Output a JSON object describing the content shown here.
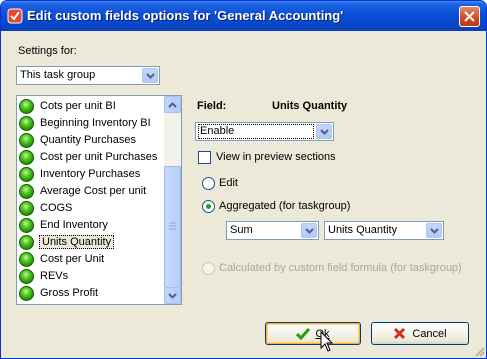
{
  "window": {
    "title": "Edit custom fields options for  'General Accounting'"
  },
  "settings": {
    "label": "Settings for:",
    "selected": "This task group"
  },
  "fields_list": {
    "items": [
      {
        "label": "Cots per unit BI"
      },
      {
        "label": "Beginning Inventory BI"
      },
      {
        "label": "Quantity Purchases"
      },
      {
        "label": "Cost per unit Purchases"
      },
      {
        "label": "Inventory Purchases"
      },
      {
        "label": "Average Cost per unit"
      },
      {
        "label": "COGS"
      },
      {
        "label": "End Inventory"
      },
      {
        "label": "Units Quantity",
        "selected": true
      },
      {
        "label": "Cost per Unit"
      },
      {
        "label": "REVs"
      },
      {
        "label": "Gross Profit"
      }
    ],
    "item_color": "#2fb012"
  },
  "field_panel": {
    "field_label": "Field:",
    "field_name": "Units Quantity",
    "mode_selected": "Enable",
    "view_in_preview_label": "View in preview sections",
    "view_in_preview_checked": false,
    "edit_label": "Edit",
    "aggregated_label": "Aggregated (for taskgroup)",
    "aggregated_selected": true,
    "aggregate_function": "Sum",
    "aggregate_field": "Units Quantity",
    "calculated_label": "Calculated by custom field formula (for taskgroup)"
  },
  "buttons": {
    "ok_label": "Ok",
    "cancel_label": "Cancel"
  },
  "colors": {
    "titlebar": "#0a4fd9",
    "dialog_bg": "#ece9d8",
    "close_button": "#d0481e",
    "ok_check": "#2a9a18",
    "cancel_x": "#d42d1a"
  }
}
